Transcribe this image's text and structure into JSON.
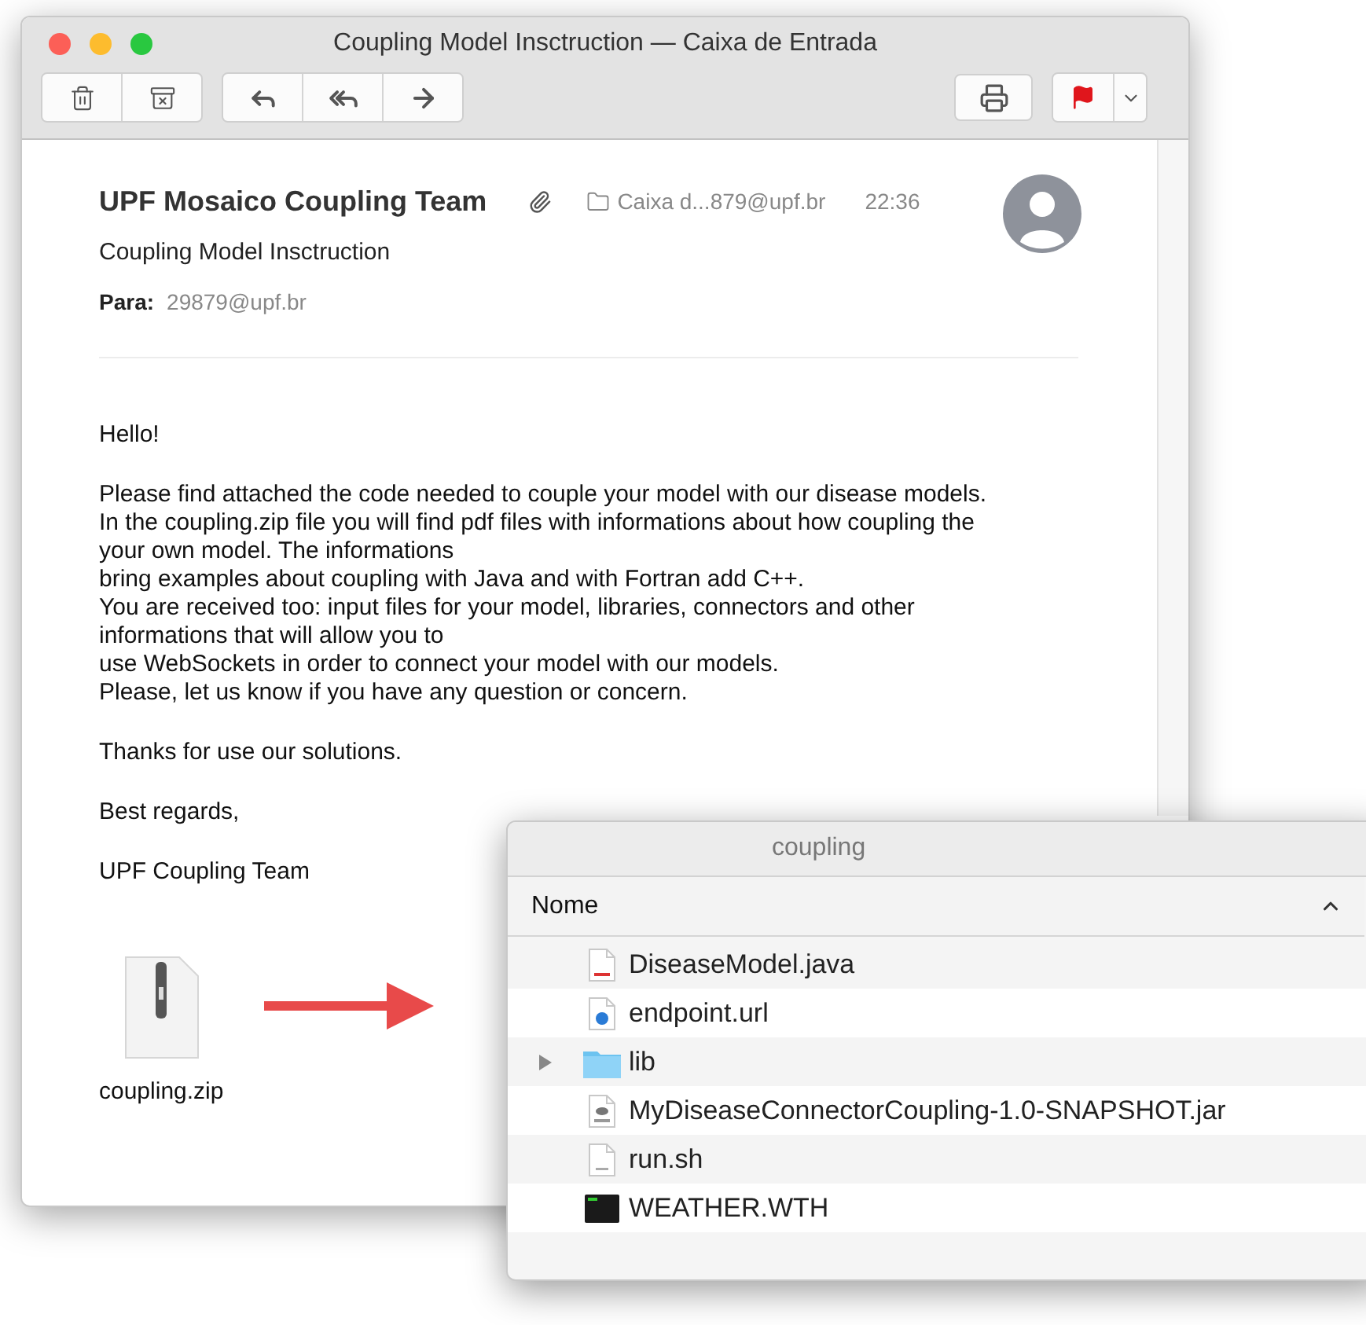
{
  "mail_window": {
    "title": "Coupling Model Insctruction — Caixa de Entrada",
    "header": {
      "sender": "UPF Mosaico Coupling Team",
      "has_attachment": true,
      "mailbox": "Caixa d...879@upf.br",
      "time": "22:36",
      "subject": "Coupling Model Insctruction",
      "to_label": "Para:",
      "to": "29879@upf.br"
    },
    "body": [
      "Hello!",
      "Please find attached the code needed to couple your model with our disease models.\nIn the coupling.zip file you will find pdf files with informations about how coupling the\nyour own model. The informations\nbring examples about coupling with Java and with Fortran add C++.\nYou are received too: input files for your model, libraries, connectors and other\ninformations that will allow you to\nuse WebSockets in order to connect your model with our models.\nPlease, let us know if you have any question or concern.",
      "Thanks for use our solutions.",
      "Best regards,",
      "UPF Coupling Team"
    ],
    "attachment": {
      "name": "coupling.zip"
    }
  },
  "finder_window": {
    "title": "coupling",
    "column": "Nome",
    "files": [
      {
        "name": "DiseaseModel.java",
        "kind": "java"
      },
      {
        "name": "endpoint.url",
        "kind": "url"
      },
      {
        "name": "lib",
        "kind": "folder",
        "expanded": false
      },
      {
        "name": "MyDiseaseConnectorCoupling-1.0-SNAPSHOT.jar",
        "kind": "jar"
      },
      {
        "name": "run.sh",
        "kind": "script"
      },
      {
        "name": "WEATHER.WTH",
        "kind": "terminal"
      }
    ]
  }
}
